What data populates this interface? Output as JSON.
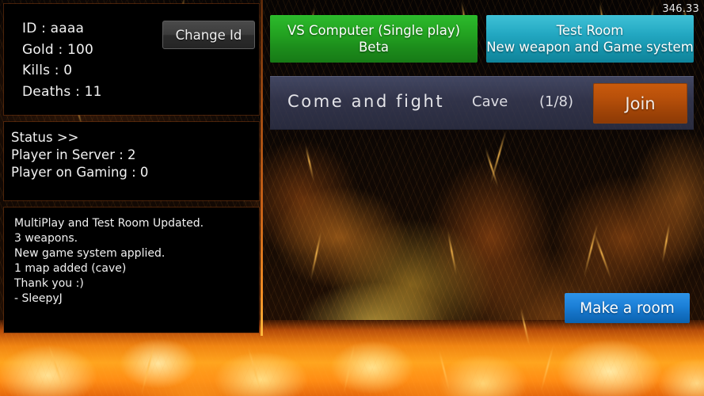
{
  "hud": {
    "fps": "346.33"
  },
  "profile": {
    "lines": [
      "ID : aaaa",
      "Gold : 100",
      "Kills : 0",
      "Deaths : 11"
    ],
    "change_id_label": "Change Id"
  },
  "status": {
    "lines": [
      "Status >>",
      "Player in Server : 2",
      "Player on Gaming : 0"
    ]
  },
  "news": {
    "lines": [
      "MultiPlay and Test Room Updated.",
      "3 weapons.",
      "New game system applied.",
      "1 map added (cave)",
      "Thank you :)",
      "- SleepyJ"
    ]
  },
  "modes": {
    "vs_computer": {
      "line1": "VS Computer (Single play)",
      "line2": "Beta",
      "color": "#23a321"
    },
    "test_room": {
      "line1": "Test Room",
      "line2": "New weapon and Game system",
      "color": "#1795ad"
    }
  },
  "rooms": {
    "list": [
      {
        "name": "Come and fight",
        "map": "Cave",
        "count": "(1/8)",
        "join_label": "Join"
      }
    ],
    "make_room_label": "Make a room"
  },
  "colors": {
    "join_button": "#b8500a",
    "make_room_button": "#1b7fd6",
    "panel_background": "#000000",
    "fire_accent": "#ff9a28"
  }
}
